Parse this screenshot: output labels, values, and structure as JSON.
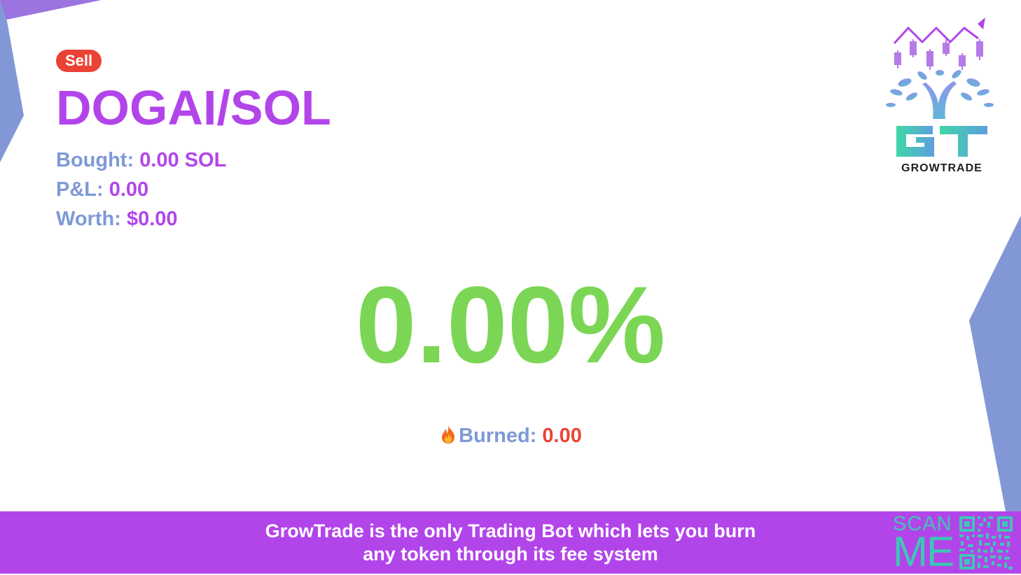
{
  "badge": {
    "label": "Sell",
    "color": "#ea4335"
  },
  "pair": "DOGAI/SOL",
  "stats": {
    "bought_label": "Bought:",
    "bought_value": "0.00 SOL",
    "pnl_label": "P&L:",
    "pnl_value": "0.00",
    "worth_label": "Worth:",
    "worth_value": "$0.00"
  },
  "percent": "0.00%",
  "burned": {
    "label": "Burned:",
    "value": "0.00",
    "icon": "fire-icon"
  },
  "logo": {
    "text": "GROWTRADE",
    "letters": "GT"
  },
  "footer": {
    "line1": "GrowTrade is the only Trading Bot which lets you burn",
    "line2": "any token through its fee system",
    "scan_line1": "SCAN",
    "scan_line2": "ME"
  },
  "colors": {
    "accent": "#b245ea",
    "label": "#7e99d6",
    "positive": "#7cd655",
    "burn": "#ea4335",
    "decor": "#8298d6",
    "teal": "#3ec6b5"
  }
}
